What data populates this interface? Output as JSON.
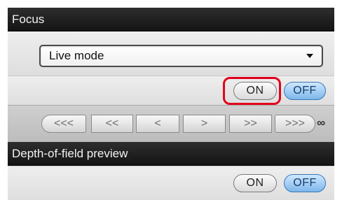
{
  "focus_section": {
    "title": "Focus",
    "mode_select": {
      "selected": "Live mode"
    },
    "toggle": {
      "on_label": "ON",
      "off_label": "OFF",
      "active": "OFF"
    },
    "focus_nav": {
      "buttons": [
        "<<<",
        "<<",
        "<",
        ">",
        ">>",
        ">>>"
      ],
      "infinity_label": "∞"
    }
  },
  "dof_section": {
    "title": "Depth-of-field preview",
    "toggle": {
      "on_label": "ON",
      "off_label": "OFF",
      "active": "OFF"
    }
  },
  "colors": {
    "header_bg": "#1e1e1e",
    "off_active_blue": "#7eb6ea",
    "highlight_red": "#e2001a"
  }
}
